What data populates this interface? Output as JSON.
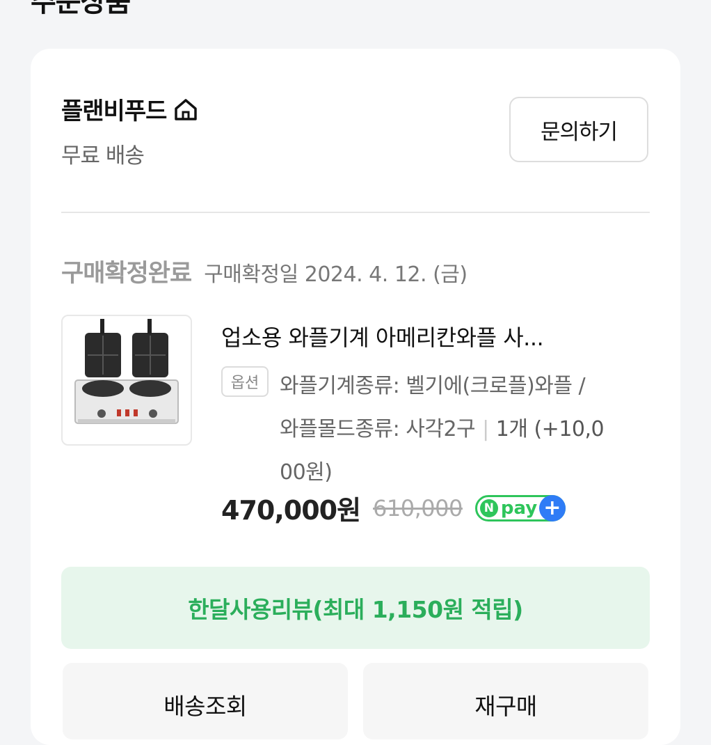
{
  "header": {
    "title": "주문상품"
  },
  "store": {
    "name": "플랜비푸드",
    "shipping": "무료 배송",
    "inquiry_label": "문의하기"
  },
  "order": {
    "status": "구매확정완료",
    "confirm_date": "구매확정일 2024. 4. 12. (금)"
  },
  "product": {
    "name": "업소용 와플기계 아메리칸와플 사...",
    "option_badge": "옵션",
    "option_line1": "와플기계종류: 벨기에(크로플)와플 /",
    "option_line2": "와플몰드종류: 사각2구",
    "quantity": "1개 (+10,0",
    "option_line3": "00원)",
    "price": "470,000원",
    "original_price": "610,000",
    "npay_label": "pay"
  },
  "actions": {
    "review_label": "한달사용리뷰(최대 1,150원 적립)",
    "delivery_label": "배송조회",
    "rebuy_label": "재구매"
  },
  "colors": {
    "accent_green": "#2bae5b",
    "npay_blue": "#2f7cf6",
    "review_bg": "#e7f6ec"
  }
}
